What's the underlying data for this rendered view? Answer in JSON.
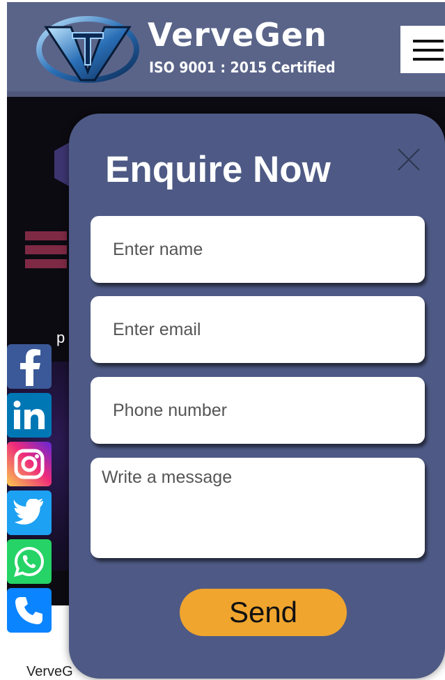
{
  "header": {
    "brand_name": "VerveGen",
    "brand_cert": "ISO 9001 : 2015 Certified",
    "logo_icon": "vg-logo-icon",
    "menu_icon": "hamburger-menu-icon"
  },
  "background": {
    "partial_text": "p",
    "footer_text": "VerveG"
  },
  "social": {
    "items": [
      {
        "name": "facebook",
        "icon": "facebook-icon",
        "label": "f"
      },
      {
        "name": "linkedin",
        "icon": "linkedin-icon",
        "label": "in"
      },
      {
        "name": "instagram",
        "icon": "instagram-icon"
      },
      {
        "name": "twitter",
        "icon": "twitter-icon"
      },
      {
        "name": "whatsapp",
        "icon": "whatsapp-icon"
      },
      {
        "name": "phone",
        "icon": "phone-icon"
      }
    ]
  },
  "modal": {
    "title": "Enquire Now",
    "close_icon": "close-icon",
    "name_placeholder": "Enter name",
    "email_placeholder": "Enter email",
    "phone_placeholder": "Phone number",
    "message_placeholder": "Write a message",
    "send_label": "Send"
  },
  "colors": {
    "header_bg": "#5a6489",
    "modal_bg": "#4e5a85",
    "send_button": "#f0a52e"
  }
}
